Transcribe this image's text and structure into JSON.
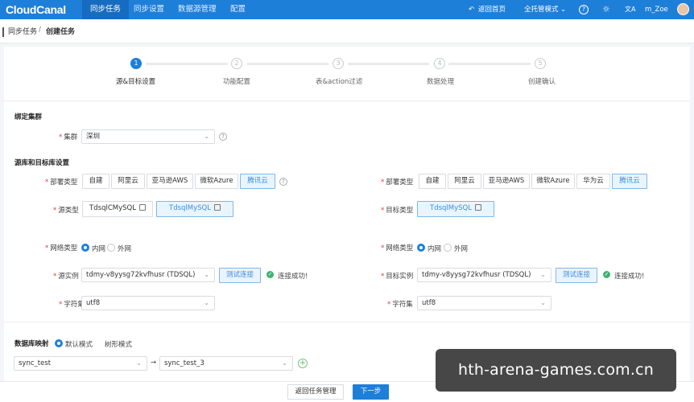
{
  "app": {
    "logo": "CloudCanal"
  },
  "topnav": {
    "items": [
      "同步任务",
      "同步设置",
      "数据源管理",
      "配置"
    ]
  },
  "topright": {
    "home": "返回首页",
    "mode": "全托管模式",
    "help": "?",
    "user": "m_Zoe"
  },
  "breadcrumb": {
    "parent": "同步任务",
    "separator": "/",
    "current": "创建任务"
  },
  "steps": [
    {
      "num": "1",
      "label": "源&目标设置"
    },
    {
      "num": "2",
      "label": "功能配置"
    },
    {
      "num": "3",
      "label": "表&action过滤"
    },
    {
      "num": "4",
      "label": "数据处理"
    },
    {
      "num": "5",
      "label": "创建确认"
    }
  ],
  "cluster": {
    "section": "绑定集群",
    "label": "集群",
    "value": "深圳"
  },
  "dbsection": "源库和目标库设置",
  "source": {
    "deploy_label": "部署类型",
    "deploy_options": [
      "自建",
      "阿里云",
      "亚马逊AWS",
      "微软Azure",
      "腾讯云"
    ],
    "type_label": "源类型",
    "types": [
      "TdsqlCMySQL",
      "TdsqlMySQL"
    ],
    "net_label": "网络类型",
    "net_options": [
      "内网",
      "外网"
    ],
    "instance_label": "源实例",
    "instance_value": "tdmy-v8yysg72kvfhusr (TDSQL)",
    "test_btn": "测试连接",
    "success": "连接成功!",
    "charset_label": "字符集",
    "charset_value": "utf8"
  },
  "target": {
    "deploy_label": "部署类型",
    "deploy_options": [
      "自建",
      "阿里云",
      "亚马逊AWS",
      "微软Azure",
      "华为云",
      "腾讯云"
    ],
    "type_label": "目标类型",
    "types": [
      "TdsqlMySQL"
    ],
    "net_label": "网络类型",
    "net_options": [
      "内网",
      "外网"
    ],
    "instance_label": "目标实例",
    "instance_value": "tdmy-v8yysg72kvfhusr (TDSQL)",
    "test_btn": "测试连接",
    "success": "连接成功!",
    "charset_label": "字符集",
    "charset_value": "utf8"
  },
  "mapping": {
    "label": "数据库映射",
    "modes": [
      "默认模式",
      "树形模式"
    ],
    "source_db": "sync_test",
    "arrow": "→",
    "target_db": "sync_test_3"
  },
  "footer": {
    "back": "返回任务管理",
    "next": "下一步"
  },
  "watermark": "hth-arena-games.com.cn",
  "colors": {
    "accent": "#1e7fd9",
    "success": "#3cb371",
    "required": "#e53935"
  }
}
